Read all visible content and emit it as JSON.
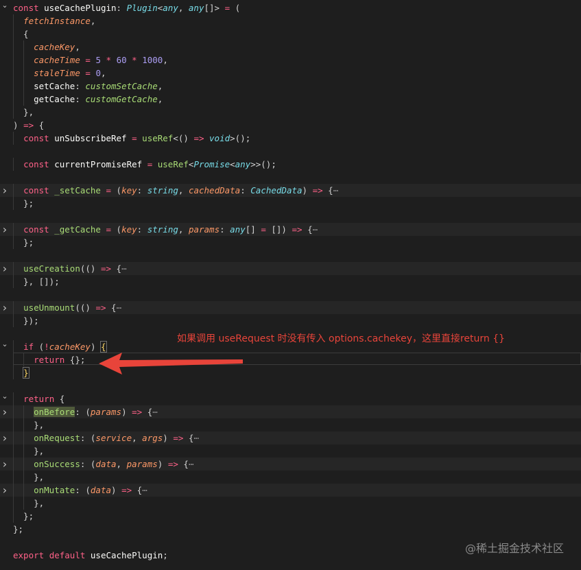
{
  "editor": {
    "lines": [
      {
        "fold": true,
        "folded": false,
        "tokens": [
          [
            "k",
            "const "
          ],
          [
            "name",
            "useCachePlugin"
          ],
          [
            "x",
            ": "
          ],
          [
            "t",
            "Plugin"
          ],
          [
            "x",
            "<"
          ],
          [
            "t",
            "any"
          ],
          [
            "x",
            ", "
          ],
          [
            "t",
            "any"
          ],
          [
            "x",
            "[]> "
          ],
          [
            "o",
            "="
          ],
          [
            "x",
            " ("
          ]
        ]
      },
      {
        "tokens": [
          [
            "x",
            "  "
          ],
          [
            "p",
            "fetchInstance"
          ],
          [
            "x",
            ","
          ]
        ]
      },
      {
        "tokens": [
          [
            "x",
            "  {"
          ]
        ]
      },
      {
        "tokens": [
          [
            "x",
            "    "
          ],
          [
            "p",
            "cacheKey"
          ],
          [
            "x",
            ","
          ]
        ]
      },
      {
        "tokens": [
          [
            "x",
            "    "
          ],
          [
            "p",
            "cacheTime"
          ],
          [
            "x",
            " "
          ],
          [
            "o",
            "="
          ],
          [
            "x",
            " "
          ],
          [
            "n",
            "5"
          ],
          [
            "x",
            " "
          ],
          [
            "o",
            "*"
          ],
          [
            "x",
            " "
          ],
          [
            "n",
            "60"
          ],
          [
            "x",
            " "
          ],
          [
            "o",
            "*"
          ],
          [
            "x",
            " "
          ],
          [
            "n",
            "1000"
          ],
          [
            "x",
            ","
          ]
        ]
      },
      {
        "tokens": [
          [
            "x",
            "    "
          ],
          [
            "p",
            "staleTime"
          ],
          [
            "x",
            " "
          ],
          [
            "o",
            "="
          ],
          [
            "x",
            " "
          ],
          [
            "n",
            "0"
          ],
          [
            "x",
            ","
          ]
        ]
      },
      {
        "tokens": [
          [
            "x",
            "    "
          ],
          [
            "name",
            "setCache"
          ],
          [
            "x",
            ": "
          ],
          [
            "fi",
            "customSetCache"
          ],
          [
            "x",
            ","
          ]
        ]
      },
      {
        "tokens": [
          [
            "x",
            "    "
          ],
          [
            "name",
            "getCache"
          ],
          [
            "x",
            ": "
          ],
          [
            "fi",
            "customGetCache"
          ],
          [
            "x",
            ","
          ]
        ]
      },
      {
        "tokens": [
          [
            "x",
            "  },"
          ]
        ]
      },
      {
        "tokens": [
          [
            "x",
            ") "
          ],
          [
            "o",
            "=>"
          ],
          [
            "x",
            " {"
          ]
        ]
      },
      {
        "tokens": [
          [
            "x",
            "  "
          ],
          [
            "k",
            "const "
          ],
          [
            "name",
            "unSubscribeRef"
          ],
          [
            "x",
            " "
          ],
          [
            "o",
            "="
          ],
          [
            "x",
            " "
          ],
          [
            "f",
            "useRef"
          ],
          [
            "x",
            "<() "
          ],
          [
            "o",
            "=>"
          ],
          [
            "x",
            " "
          ],
          [
            "t",
            "void"
          ],
          [
            "x",
            ">();"
          ]
        ]
      },
      {
        "tokens": []
      },
      {
        "tokens": [
          [
            "x",
            "  "
          ],
          [
            "k",
            "const "
          ],
          [
            "name",
            "currentPromiseRef"
          ],
          [
            "x",
            " "
          ],
          [
            "o",
            "="
          ],
          [
            "x",
            " "
          ],
          [
            "f",
            "useRef"
          ],
          [
            "x",
            "<"
          ],
          [
            "t",
            "Promise"
          ],
          [
            "x",
            "<"
          ],
          [
            "t",
            "any"
          ],
          [
            "x",
            ">>();"
          ]
        ]
      },
      {
        "tokens": []
      },
      {
        "fold": true,
        "folded": true,
        "highlight": true,
        "tokens": [
          [
            "x",
            "  "
          ],
          [
            "k",
            "const "
          ],
          [
            "f",
            "_setCache"
          ],
          [
            "x",
            " "
          ],
          [
            "o",
            "="
          ],
          [
            "x",
            " ("
          ],
          [
            "p",
            "key"
          ],
          [
            "x",
            ": "
          ],
          [
            "t",
            "string"
          ],
          [
            "x",
            ", "
          ],
          [
            "p",
            "cachedData"
          ],
          [
            "x",
            ": "
          ],
          [
            "t",
            "CachedData"
          ],
          [
            "x",
            ") "
          ],
          [
            "o",
            "=>"
          ],
          [
            "x",
            " {"
          ],
          [
            "pl",
            "⋯"
          ]
        ]
      },
      {
        "tokens": [
          [
            "x",
            "  };"
          ]
        ]
      },
      {
        "tokens": []
      },
      {
        "fold": true,
        "folded": true,
        "highlight": true,
        "tokens": [
          [
            "x",
            "  "
          ],
          [
            "k",
            "const "
          ],
          [
            "f",
            "_getCache"
          ],
          [
            "x",
            " "
          ],
          [
            "o",
            "="
          ],
          [
            "x",
            " ("
          ],
          [
            "p",
            "key"
          ],
          [
            "x",
            ": "
          ],
          [
            "t",
            "string"
          ],
          [
            "x",
            ", "
          ],
          [
            "p",
            "params"
          ],
          [
            "x",
            ": "
          ],
          [
            "t",
            "any"
          ],
          [
            "x",
            "[] "
          ],
          [
            "o",
            "="
          ],
          [
            "x",
            " []) "
          ],
          [
            "o",
            "=>"
          ],
          [
            "x",
            " {"
          ],
          [
            "pl",
            "⋯"
          ]
        ]
      },
      {
        "tokens": [
          [
            "x",
            "  };"
          ]
        ]
      },
      {
        "tokens": []
      },
      {
        "fold": true,
        "folded": true,
        "highlight": true,
        "tokens": [
          [
            "x",
            "  "
          ],
          [
            "f",
            "useCreation"
          ],
          [
            "x",
            "(() "
          ],
          [
            "o",
            "=>"
          ],
          [
            "x",
            " {"
          ],
          [
            "pl",
            "⋯"
          ]
        ]
      },
      {
        "tokens": [
          [
            "x",
            "  }, []);"
          ]
        ]
      },
      {
        "tokens": []
      },
      {
        "fold": true,
        "folded": true,
        "highlight": true,
        "tokens": [
          [
            "x",
            "  "
          ],
          [
            "f",
            "useUnmount"
          ],
          [
            "x",
            "(() "
          ],
          [
            "o",
            "=>"
          ],
          [
            "x",
            " {"
          ],
          [
            "pl",
            "⋯"
          ]
        ]
      },
      {
        "tokens": [
          [
            "x",
            "  });"
          ]
        ]
      },
      {
        "tokens": []
      },
      {
        "fold": true,
        "folded": false,
        "tokens": [
          [
            "x",
            "  "
          ],
          [
            "k",
            "if"
          ],
          [
            "x",
            " ("
          ],
          [
            "o",
            "!"
          ],
          [
            "p",
            "cacheKey"
          ],
          [
            "x",
            ") "
          ],
          [
            "box",
            "{"
          ]
        ]
      },
      {
        "tokens": [
          [
            "x",
            "    "
          ],
          [
            "k",
            "return"
          ],
          [
            "x",
            " {};"
          ]
        ]
      },
      {
        "tokens": [
          [
            "x",
            "  "
          ],
          [
            "box",
            "}"
          ]
        ]
      },
      {
        "tokens": []
      },
      {
        "fold": true,
        "folded": false,
        "tokens": [
          [
            "x",
            "  "
          ],
          [
            "k",
            "return"
          ],
          [
            "x",
            " {"
          ]
        ]
      },
      {
        "fold": true,
        "folded": true,
        "highlight": true,
        "tokens": [
          [
            "x",
            "    "
          ],
          [
            "hl",
            "onBefore"
          ],
          [
            "x",
            ": ("
          ],
          [
            "p",
            "params"
          ],
          [
            "x",
            ") "
          ],
          [
            "o",
            "=>"
          ],
          [
            "x",
            " {"
          ],
          [
            "pl",
            "⋯"
          ]
        ]
      },
      {
        "tokens": [
          [
            "x",
            "    },"
          ]
        ]
      },
      {
        "fold": true,
        "folded": true,
        "highlight": true,
        "tokens": [
          [
            "x",
            "    "
          ],
          [
            "f",
            "onRequest"
          ],
          [
            "x",
            ": ("
          ],
          [
            "p",
            "service"
          ],
          [
            "x",
            ", "
          ],
          [
            "p",
            "args"
          ],
          [
            "x",
            ") "
          ],
          [
            "o",
            "=>"
          ],
          [
            "x",
            " {"
          ],
          [
            "pl",
            "⋯"
          ]
        ]
      },
      {
        "tokens": [
          [
            "x",
            "    },"
          ]
        ]
      },
      {
        "fold": true,
        "folded": true,
        "highlight": true,
        "tokens": [
          [
            "x",
            "    "
          ],
          [
            "f",
            "onSuccess"
          ],
          [
            "x",
            ": ("
          ],
          [
            "p",
            "data"
          ],
          [
            "x",
            ", "
          ],
          [
            "p",
            "params"
          ],
          [
            "x",
            ") "
          ],
          [
            "o",
            "=>"
          ],
          [
            "x",
            " {"
          ],
          [
            "pl",
            "⋯"
          ]
        ]
      },
      {
        "tokens": [
          [
            "x",
            "    },"
          ]
        ]
      },
      {
        "fold": true,
        "folded": true,
        "highlight": true,
        "tokens": [
          [
            "x",
            "    "
          ],
          [
            "f",
            "onMutate"
          ],
          [
            "x",
            ": ("
          ],
          [
            "p",
            "data"
          ],
          [
            "x",
            ") "
          ],
          [
            "o",
            "=>"
          ],
          [
            "x",
            " {"
          ],
          [
            "pl",
            "⋯"
          ]
        ]
      },
      {
        "tokens": [
          [
            "x",
            "    },"
          ]
        ]
      },
      {
        "tokens": [
          [
            "x",
            "  };"
          ]
        ]
      },
      {
        "tokens": [
          [
            "x",
            "};"
          ]
        ]
      },
      {
        "tokens": []
      },
      {
        "tokens": [
          [
            "k",
            "export "
          ],
          [
            "k",
            "default "
          ],
          [
            "name",
            "useCachePlugin"
          ],
          [
            "x",
            ";"
          ]
        ]
      }
    ]
  },
  "annotation": {
    "text": "如果调用 useRequest 时没有传入 options.cachekey，这里直接return {}",
    "color": "#e8443a"
  },
  "watermark": {
    "text": "@稀土掘金技术社区"
  },
  "icons": {
    "fold_collapsed": "chevron-right-icon",
    "fold_expanded": "chevron-down-icon"
  }
}
